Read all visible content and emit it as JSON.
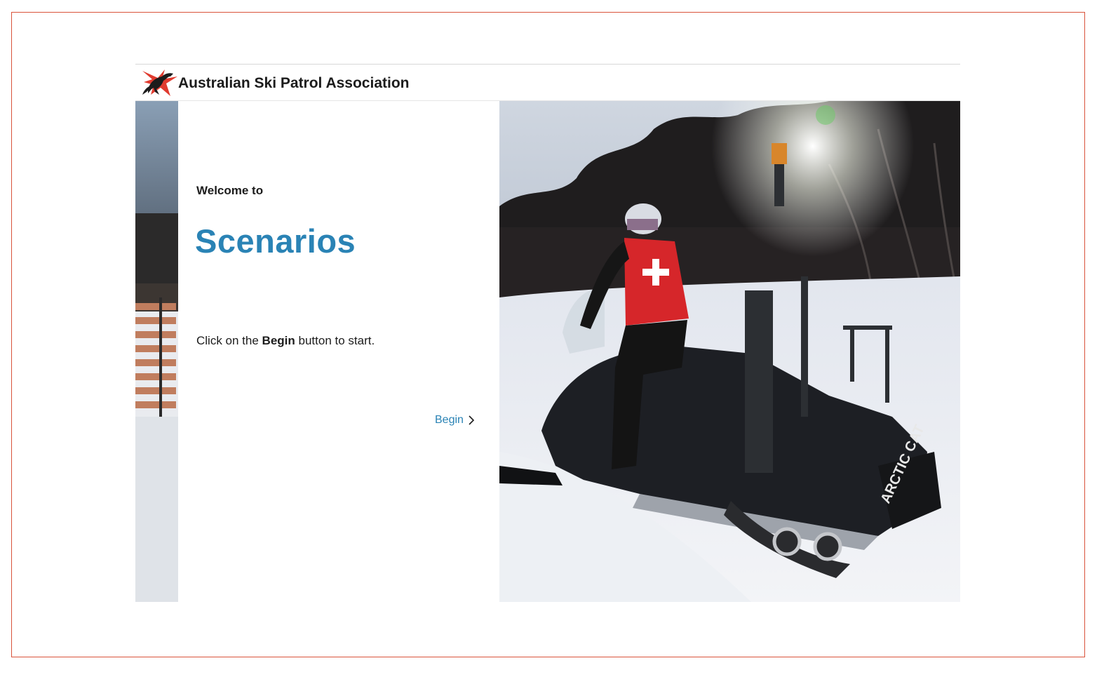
{
  "header": {
    "org_name": "Australian Ski Patrol Association",
    "logo_icon": "kangaroo-logo-icon"
  },
  "content": {
    "welcome": "Welcome to",
    "title": "Scenarios",
    "instruction_prefix": "Click on the ",
    "instruction_bold": "Begin",
    "instruction_suffix": " button to start.",
    "begin_label": "Begin",
    "begin_icon": "chevron-right-icon"
  },
  "photo": {
    "subject": "ski-patroller-on-snowmobile-image",
    "vehicle_text": "ARCTIC CAT"
  },
  "colors": {
    "accent": "#2a83b5",
    "frame_border": "#d9533b",
    "logo_red": "#e03b2f"
  }
}
